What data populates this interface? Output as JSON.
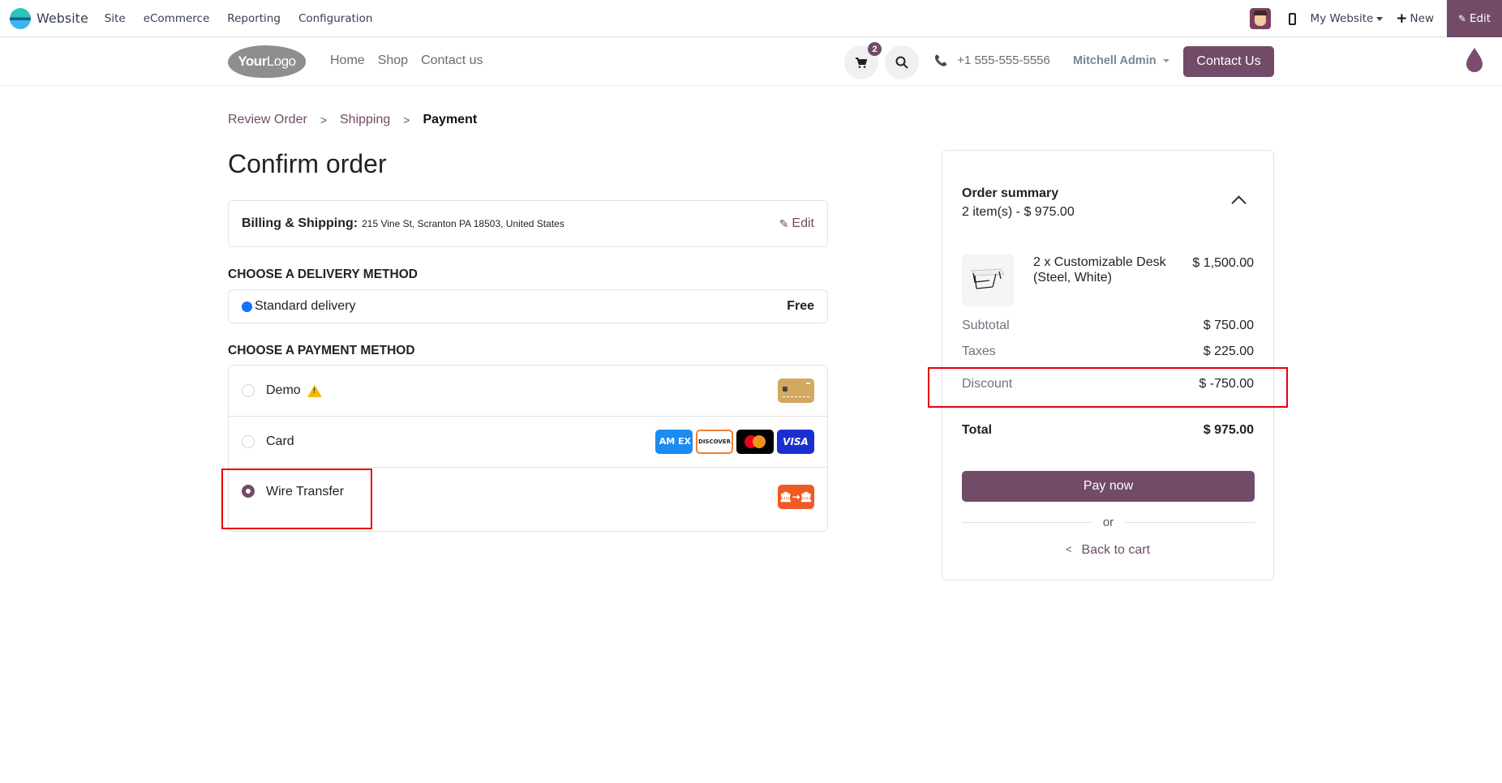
{
  "topbar": {
    "app_name": "Website",
    "menu": [
      "Site",
      "eCommerce",
      "Reporting",
      "Configuration"
    ],
    "website_selector": "My Website",
    "new_label": "New",
    "edit_label": "Edit"
  },
  "site_header": {
    "logo_bold": "Your",
    "logo_light": "Logo",
    "nav": [
      "Home",
      "Shop",
      "Contact us"
    ],
    "cart_count": "2",
    "phone": "+1 555-555-5556",
    "user": "Mitchell Admin",
    "contact_button": "Contact Us"
  },
  "breadcrumb": {
    "items": [
      "Review Order",
      "Shipping"
    ],
    "current": "Payment",
    "separator": ">"
  },
  "page_title": "Confirm order",
  "billing": {
    "label": "Billing & Shipping:",
    "address": "215 Vine St, Scranton PA 18503, United States",
    "edit_label": "Edit"
  },
  "delivery": {
    "heading": "Choose a delivery method",
    "methods": [
      {
        "name": "Standard delivery",
        "price": "Free",
        "selected": true
      }
    ]
  },
  "payment": {
    "heading": "Choose a payment method",
    "methods": [
      {
        "name": "Demo",
        "selected": false,
        "warning": true,
        "icons": [
          "demo-card-icon"
        ]
      },
      {
        "name": "Card",
        "selected": false,
        "icons": [
          "amex-icon",
          "discover-icon",
          "mastercard-icon",
          "visa-icon"
        ]
      },
      {
        "name": "Wire Transfer",
        "selected": true,
        "icons": [
          "wire-transfer-icon"
        ]
      }
    ],
    "icon_text": {
      "amex": "AM EX",
      "discover": "DISCOVER",
      "visa": "VISA",
      "wire": "🏛→🏛"
    }
  },
  "summary": {
    "title": "Order summary",
    "subtitle": "2 item(s) -  $ 975.00",
    "product": {
      "name": "2 x Customizable Desk (Steel, White)",
      "price": "$ 1,500.00"
    },
    "rows": [
      {
        "label": "Subtotal",
        "value": "$ 750.00"
      },
      {
        "label": "Taxes",
        "value": "$ 225.00"
      },
      {
        "label": "Discount",
        "value": "$ -750.00"
      }
    ],
    "total": {
      "label": "Total",
      "value": "$ 975.00"
    },
    "pay_now": "Pay now",
    "or": "or",
    "back_to_cart": "Back to cart"
  },
  "colors": {
    "brand": "#714b67",
    "highlight": "#e8000b",
    "radio_blue": "#0d6efd",
    "warning": "#f5b800",
    "wire_icon": "#ee5a24"
  }
}
